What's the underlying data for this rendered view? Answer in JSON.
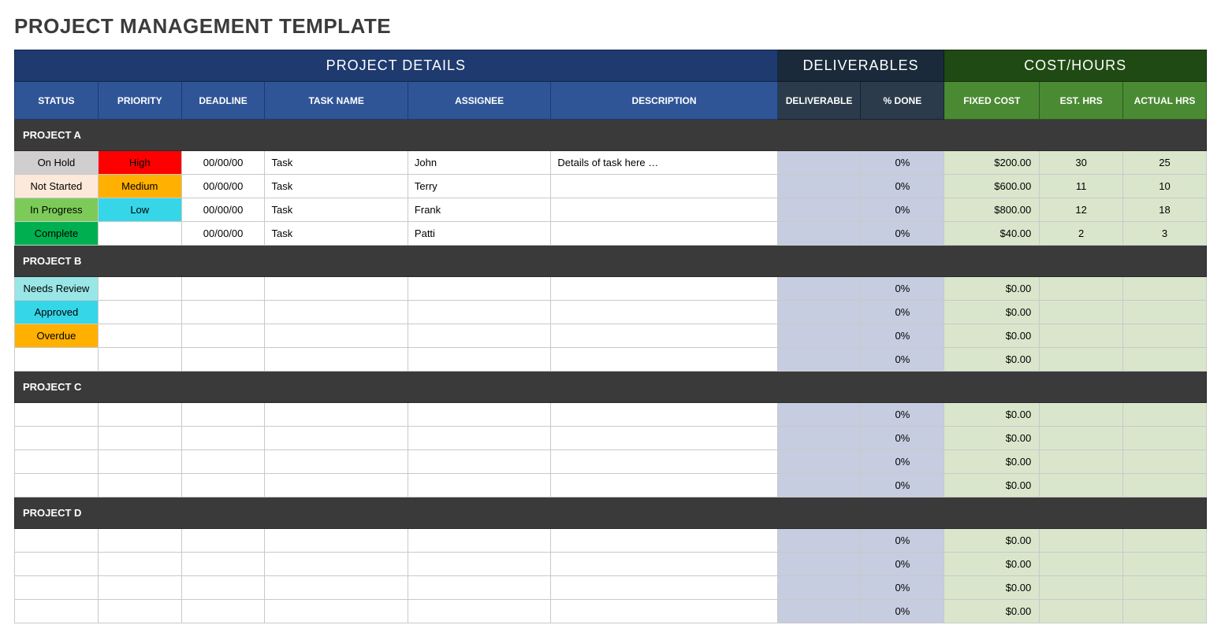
{
  "title": "PROJECT MANAGEMENT TEMPLATE",
  "groups": {
    "details": "PROJECT DETAILS",
    "deliverables": "DELIVERABLES",
    "costhours": "COST/HOURS"
  },
  "cols": {
    "status": "STATUS",
    "priority": "PRIORITY",
    "deadline": "DEADLINE",
    "task": "TASK NAME",
    "assignee": "ASSIGNEE",
    "desc": "DESCRIPTION",
    "deliv": "DELIVERABLE",
    "done": "% DONE",
    "fixed": "FIXED COST",
    "est": "EST. HRS",
    "actual": "ACTUAL HRS"
  },
  "sections": [
    {
      "name": "PROJECT A",
      "rows": [
        {
          "status": "On Hold",
          "statusCls": "st-onhold",
          "priority": "High",
          "priorityCls": "pr-high",
          "deadline": "00/00/00",
          "task": "Task",
          "assignee": "John",
          "desc": "Details of task here …",
          "deliv": "",
          "done": "0%",
          "fixed": "$200.00",
          "est": "30",
          "actual": "25"
        },
        {
          "status": "Not Started",
          "statusCls": "st-notstarted",
          "priority": "Medium",
          "priorityCls": "pr-medium",
          "deadline": "00/00/00",
          "task": "Task",
          "assignee": "Terry",
          "desc": "",
          "deliv": "",
          "done": "0%",
          "fixed": "$600.00",
          "est": "11",
          "actual": "10"
        },
        {
          "status": "In Progress",
          "statusCls": "st-inprogress",
          "priority": "Low",
          "priorityCls": "pr-low",
          "deadline": "00/00/00",
          "task": "Task",
          "assignee": "Frank",
          "desc": "",
          "deliv": "",
          "done": "0%",
          "fixed": "$800.00",
          "est": "12",
          "actual": "18"
        },
        {
          "status": "Complete",
          "statusCls": "st-complete",
          "priority": "",
          "priorityCls": "",
          "deadline": "00/00/00",
          "task": "Task",
          "assignee": "Patti",
          "desc": "",
          "deliv": "",
          "done": "0%",
          "fixed": "$40.00",
          "est": "2",
          "actual": "3"
        }
      ]
    },
    {
      "name": "PROJECT B",
      "rows": [
        {
          "status": "Needs Review",
          "statusCls": "st-needsreview",
          "priority": "",
          "priorityCls": "",
          "deadline": "",
          "task": "",
          "assignee": "",
          "desc": "",
          "deliv": "",
          "done": "0%",
          "fixed": "$0.00",
          "est": "",
          "actual": ""
        },
        {
          "status": "Approved",
          "statusCls": "st-approved",
          "priority": "",
          "priorityCls": "",
          "deadline": "",
          "task": "",
          "assignee": "",
          "desc": "",
          "deliv": "",
          "done": "0%",
          "fixed": "$0.00",
          "est": "",
          "actual": ""
        },
        {
          "status": "Overdue",
          "statusCls": "st-overdue",
          "priority": "",
          "priorityCls": "",
          "deadline": "",
          "task": "",
          "assignee": "",
          "desc": "",
          "deliv": "",
          "done": "0%",
          "fixed": "$0.00",
          "est": "",
          "actual": ""
        },
        {
          "status": "",
          "statusCls": "",
          "priority": "",
          "priorityCls": "",
          "deadline": "",
          "task": "",
          "assignee": "",
          "desc": "",
          "deliv": "",
          "done": "0%",
          "fixed": "$0.00",
          "est": "",
          "actual": ""
        }
      ]
    },
    {
      "name": "PROJECT C",
      "rows": [
        {
          "status": "",
          "statusCls": "",
          "priority": "",
          "priorityCls": "",
          "deadline": "",
          "task": "",
          "assignee": "",
          "desc": "",
          "deliv": "",
          "done": "0%",
          "fixed": "$0.00",
          "est": "",
          "actual": ""
        },
        {
          "status": "",
          "statusCls": "",
          "priority": "",
          "priorityCls": "",
          "deadline": "",
          "task": "",
          "assignee": "",
          "desc": "",
          "deliv": "",
          "done": "0%",
          "fixed": "$0.00",
          "est": "",
          "actual": ""
        },
        {
          "status": "",
          "statusCls": "",
          "priority": "",
          "priorityCls": "",
          "deadline": "",
          "task": "",
          "assignee": "",
          "desc": "",
          "deliv": "",
          "done": "0%",
          "fixed": "$0.00",
          "est": "",
          "actual": ""
        },
        {
          "status": "",
          "statusCls": "",
          "priority": "",
          "priorityCls": "",
          "deadline": "",
          "task": "",
          "assignee": "",
          "desc": "",
          "deliv": "",
          "done": "0%",
          "fixed": "$0.00",
          "est": "",
          "actual": ""
        }
      ]
    },
    {
      "name": "PROJECT D",
      "rows": [
        {
          "status": "",
          "statusCls": "",
          "priority": "",
          "priorityCls": "",
          "deadline": "",
          "task": "",
          "assignee": "",
          "desc": "",
          "deliv": "",
          "done": "0%",
          "fixed": "$0.00",
          "est": "",
          "actual": ""
        },
        {
          "status": "",
          "statusCls": "",
          "priority": "",
          "priorityCls": "",
          "deadline": "",
          "task": "",
          "assignee": "",
          "desc": "",
          "deliv": "",
          "done": "0%",
          "fixed": "$0.00",
          "est": "",
          "actual": ""
        },
        {
          "status": "",
          "statusCls": "",
          "priority": "",
          "priorityCls": "",
          "deadline": "",
          "task": "",
          "assignee": "",
          "desc": "",
          "deliv": "",
          "done": "0%",
          "fixed": "$0.00",
          "est": "",
          "actual": ""
        },
        {
          "status": "",
          "statusCls": "",
          "priority": "",
          "priorityCls": "",
          "deadline": "",
          "task": "",
          "assignee": "",
          "desc": "",
          "deliv": "",
          "done": "0%",
          "fixed": "$0.00",
          "est": "",
          "actual": ""
        }
      ]
    }
  ]
}
